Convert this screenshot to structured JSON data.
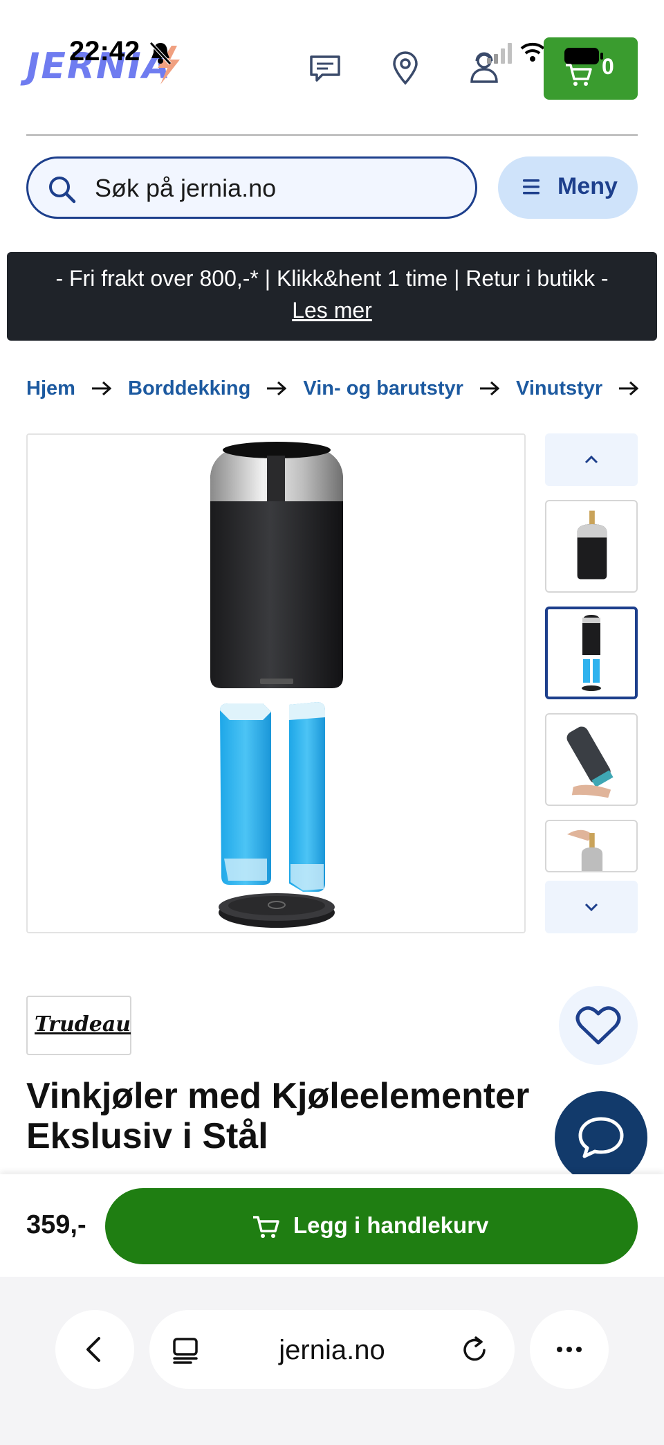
{
  "status_bar": {
    "time": "22:42"
  },
  "header": {
    "logo_text": "JERNIA",
    "cart_count": "0",
    "search_placeholder": "Søk på jernia.no",
    "menu_label": "Meny",
    "icons": [
      "chat-bubble-icon",
      "location-pin-icon",
      "customer-service-icon",
      "cart-icon"
    ]
  },
  "banner": {
    "text": "- Fri frakt over 800,-* | Klikk&hent 1 time | Retur i butikk -",
    "link": "Les mer"
  },
  "breadcrumb": [
    "Hjem",
    "Borddekking",
    "Vin- og barutstyr",
    "Vinutstyr"
  ],
  "gallery": {
    "thumbnail_count": 4,
    "active_thumbnail": 2
  },
  "product": {
    "brand": "Trudeau",
    "title_line1": "Vinkjøler med Kjøleelementer",
    "title_line2": "Ekslusiv i Stål",
    "price": "359,-",
    "add_to_cart_label": "Legg i handlekurv"
  },
  "browser": {
    "url": "jernia.no"
  },
  "colors": {
    "brand_blue": "#1d3f8c",
    "cart_green": "#3a9c2f",
    "buy_green": "#1f7e12",
    "banner_dark": "#1f2329",
    "chat_navy": "#123a6b"
  }
}
